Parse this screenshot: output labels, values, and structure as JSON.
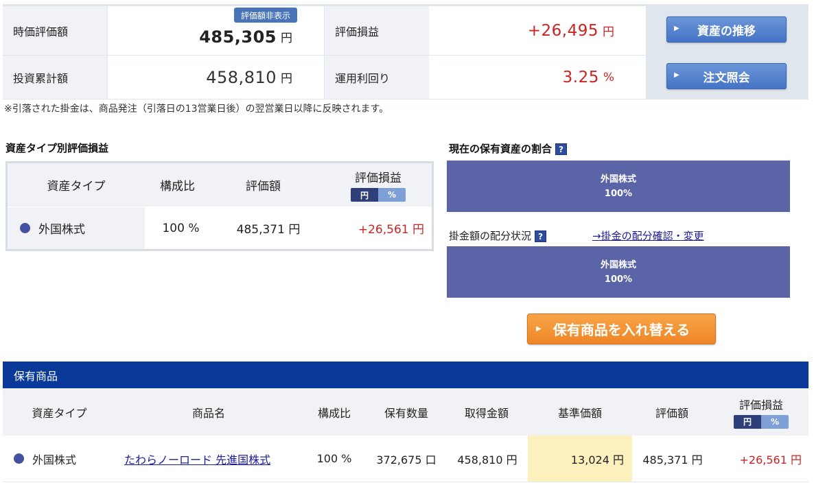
{
  "summary": {
    "market_value_label": "時価評価額",
    "market_value": "485,305",
    "hide_badge": "評価額非表示",
    "unrealized_label": "評価損益",
    "unrealized_value": "+26,495",
    "invested_label": "投資累計額",
    "invested_value": "458,810",
    "yield_label": "運用利回り",
    "yield_value": "3.25",
    "yen_unit": "円",
    "pct_unit": "%",
    "btn_history": "資産の推移",
    "btn_orders": "注文照会"
  },
  "note": "※引落された掛金は、商品発注（引落日の13営業日後）の翌営業日以降に反映されます。",
  "asset_type": {
    "title": "資産タイプ別評価損益",
    "headers": {
      "type": "資産タイプ",
      "ratio": "構成比",
      "value": "評価額",
      "gain": "評価損益"
    },
    "toggle": {
      "yen": "円",
      "pct": "%"
    },
    "row": {
      "type": "外国株式",
      "ratio": "100 %",
      "value": "485,371 円",
      "gain": "+26,561 円"
    }
  },
  "holdings_ratio": {
    "title": "現在の保有資産の割合",
    "help": "?",
    "bar_label": "外国株式",
    "bar_pct": "100%"
  },
  "allocation": {
    "label": "掛金額の配分状況",
    "help": "?",
    "link": "→掛金の配分確認・変更",
    "bar_label": "外国株式",
    "bar_pct": "100%"
  },
  "switch_button": "保有商品を入れ替える",
  "holdings": {
    "title": "保有商品",
    "headers": {
      "type": "資産タイプ",
      "name": "商品名",
      "ratio": "構成比",
      "qty": "保有数量",
      "cost": "取得金額",
      "nav": "基準価額",
      "value": "評価額",
      "gain": "評価損益"
    },
    "toggle": {
      "yen": "円",
      "pct": "%"
    },
    "rows": [
      {
        "type": "外国株式",
        "name": "たわらノーロード 先進国株式",
        "ratio": "100 %",
        "qty": "372,675 口",
        "cost": "458,810 円",
        "nav": "13,024 円",
        "value": "485,371 円",
        "gain": "+26,561 円"
      }
    ]
  },
  "colors": {
    "gain_red": "#cc2222",
    "button_blue": "#4474c6",
    "button_orange": "#ee8626",
    "header_navy": "#093a9a",
    "bar_purple": "#5c64a8",
    "dot_color": "#4650a0"
  }
}
